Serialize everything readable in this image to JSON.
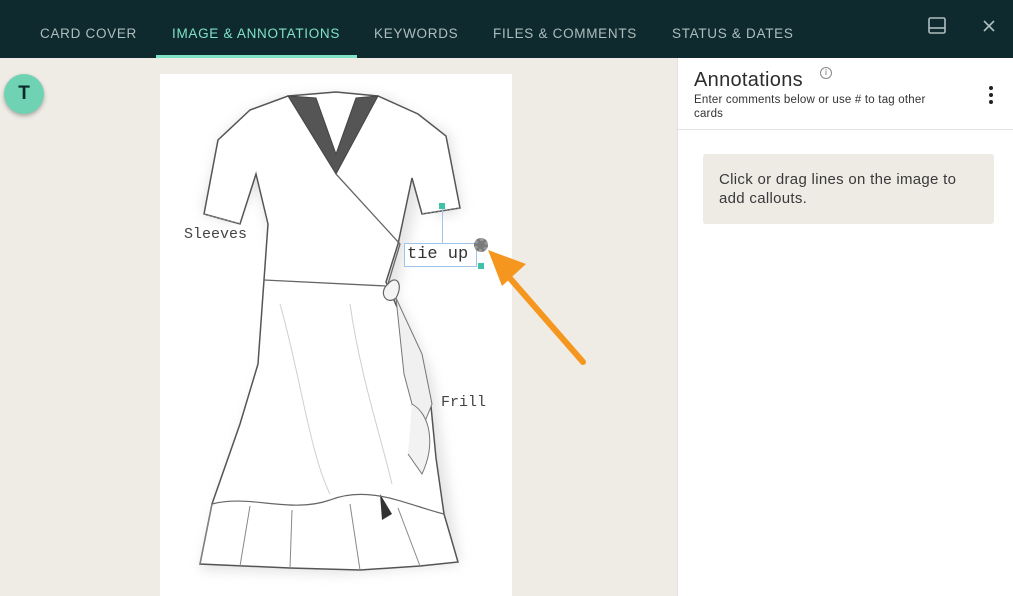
{
  "tabs": [
    {
      "label": "CARD COVER",
      "active": false
    },
    {
      "label": "IMAGE & ANNOTATIONS",
      "active": true
    },
    {
      "label": "KEYWORDS",
      "active": false
    },
    {
      "label": "FILES & COMMENTS",
      "active": false
    },
    {
      "label": "STATUS & DATES",
      "active": false
    }
  ],
  "toolbar": {
    "layout_icon": "panel-layout-icon",
    "close_icon": "close-icon"
  },
  "avatar": {
    "initial": "T"
  },
  "image": {
    "callouts": {
      "sleeves": "Sleeves",
      "tie_up": "tie up",
      "frill": "Frill"
    }
  },
  "panel": {
    "title": "Annotations",
    "info_glyph": "i",
    "subtitle": "Enter comments below or use # to tag other cards",
    "hint": "Click or drag lines on the image to add callouts."
  },
  "colors": {
    "tabbar": "#0f2a2e",
    "accent": "#7fe3c7",
    "canvas": "#efece6",
    "arrow": "#f5961e"
  }
}
